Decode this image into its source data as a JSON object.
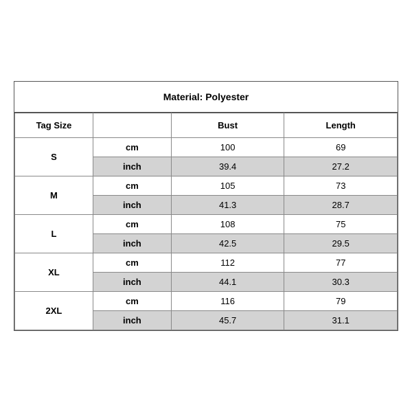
{
  "title": "Material: Polyester",
  "columns": {
    "tag_size": "Tag Size",
    "bust": "Bust",
    "length": "Length"
  },
  "rows": [
    {
      "size": "S",
      "cm": {
        "bust": "100",
        "length": "69"
      },
      "inch": {
        "bust": "39.4",
        "length": "27.2"
      }
    },
    {
      "size": "M",
      "cm": {
        "bust": "105",
        "length": "73"
      },
      "inch": {
        "bust": "41.3",
        "length": "28.7"
      }
    },
    {
      "size": "L",
      "cm": {
        "bust": "108",
        "length": "75"
      },
      "inch": {
        "bust": "42.5",
        "length": "29.5"
      }
    },
    {
      "size": "XL",
      "cm": {
        "bust": "112",
        "length": "77"
      },
      "inch": {
        "bust": "44.1",
        "length": "30.3"
      }
    },
    {
      "size": "2XL",
      "cm": {
        "bust": "116",
        "length": "79"
      },
      "inch": {
        "bust": "45.7",
        "length": "31.1"
      }
    }
  ],
  "units": {
    "cm": "cm",
    "inch": "inch"
  }
}
